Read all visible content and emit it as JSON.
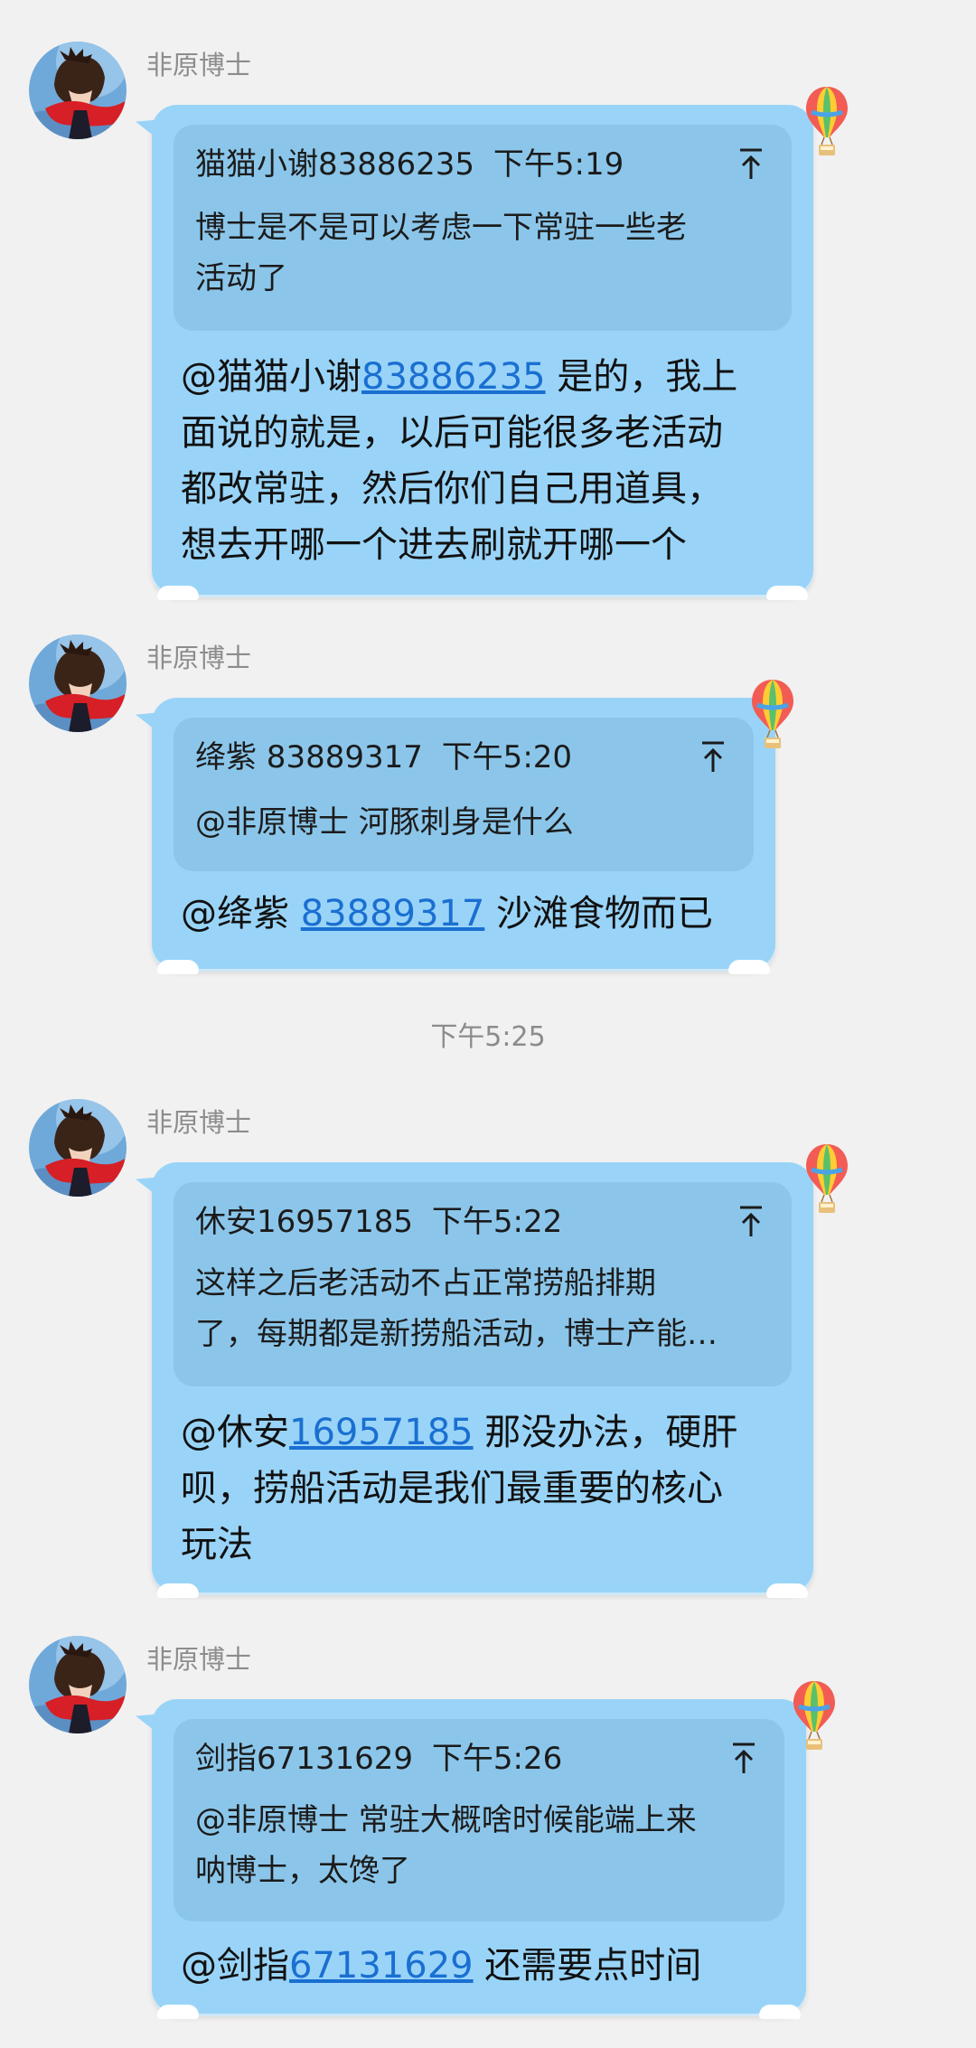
{
  "messages": [
    {
      "sender": "非原博士",
      "quote": {
        "author": "猫猫小谢83886235",
        "time": "下午5:19",
        "line1": "博士是不是可以考虑一下常驻一些老",
        "line2": "活动了"
      },
      "reply": {
        "mention_name": "@猫猫小谢",
        "mention_number": "83886235",
        "line1_rest": " 是的，我上",
        "line2": "面说的就是，以后可能很多老活动",
        "line3": "都改常驻，然后你们自己用道具，",
        "line4": "想去开哪一个进去刷就开哪一个"
      }
    },
    {
      "sender": "非原博士",
      "quote": {
        "author": "绛紫 83889317",
        "time": "下午5:20",
        "line1": "@非原博士 河豚刺身是什么"
      },
      "reply": {
        "mention_name": "@绛紫 ",
        "mention_number": "83889317",
        "line1_rest": " 沙滩食物而已"
      }
    },
    {
      "sender": "非原博士",
      "quote": {
        "author": "休安16957185",
        "time": "下午5:22",
        "line1": "这样之后老活动不占正常捞船排期",
        "line2": "了，每期都是新捞船活动，博士产能…"
      },
      "reply": {
        "mention_name": "@休安",
        "mention_number": "16957185",
        "line1_rest": " 那没办法，硬肝",
        "line2": "呗，捞船活动是我们最重要的核心",
        "line3": "玩法"
      }
    },
    {
      "sender": "非原博士",
      "quote": {
        "author": "剑指67131629",
        "time": "下午5:26",
        "line1": "@非原博士 常驻大概啥时候能端上来",
        "line2": "呐博士，太馋了"
      },
      "reply": {
        "mention_name": "@剑指",
        "mention_number": "67131629",
        "line1_rest": " 还需要点时间"
      }
    }
  ],
  "time_separator": "下午5:25",
  "icons": {
    "avatar": "avatar-character-red-scarf",
    "balloon": "hot-air-balloon-icon",
    "jump_to_quote": "arrow-up-to-top-icon"
  },
  "colors": {
    "background": "#f1f1f1",
    "bubble": "#99d4f8",
    "quote_box": "#8bc6ea",
    "mention_link": "#1a6fd1",
    "sender_name": "#8c8c8c"
  }
}
